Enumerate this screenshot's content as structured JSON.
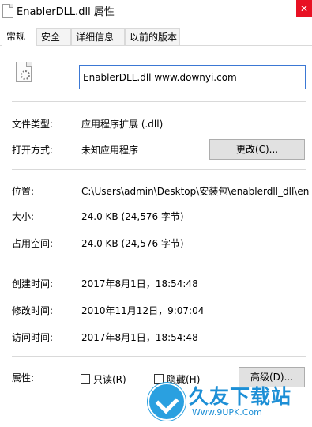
{
  "window": {
    "title": "EnablerDLL.dll 属性",
    "close_label": "✕"
  },
  "tabs": [
    "常规",
    "安全",
    "详细信息",
    "以前的版本"
  ],
  "file": {
    "name": "EnablerDLL.dll www.downyi.com"
  },
  "rows": {
    "type": {
      "label": "文件类型:",
      "value": "应用程序扩展 (.dll)"
    },
    "opens_with": {
      "label": "打开方式:",
      "value": "未知应用程序",
      "button": "更改(C)..."
    },
    "location": {
      "label": "位置:",
      "value": "C:\\Users\\admin\\Desktop\\安装包\\enablerdll_dll\\en"
    },
    "size": {
      "label": "大小:",
      "value": "24.0 KB (24,576 字节)"
    },
    "size_on_disk": {
      "label": "占用空间:",
      "value": "24.0 KB (24,576 字节)"
    },
    "created": {
      "label": "创建时间:",
      "value": "2017年8月1日，18:54:48"
    },
    "modified": {
      "label": "修改时间:",
      "value": "2010年11月12日，9:07:04"
    },
    "accessed": {
      "label": "访问时间:",
      "value": "2017年8月1日，18:54:48"
    }
  },
  "attributes": {
    "label": "属性:",
    "readonly": {
      "label": "只读(R)",
      "checked": false
    },
    "hidden": {
      "label": "隐藏(H)",
      "checked": false
    },
    "advanced_button": "高级(D)..."
  },
  "watermark": {
    "text": "久友下载站",
    "url": "Www.9UPK.Com"
  },
  "colors": {
    "close": "#e81123",
    "focus_border": "#3b78d4",
    "watermark": "#1d8fd6"
  }
}
